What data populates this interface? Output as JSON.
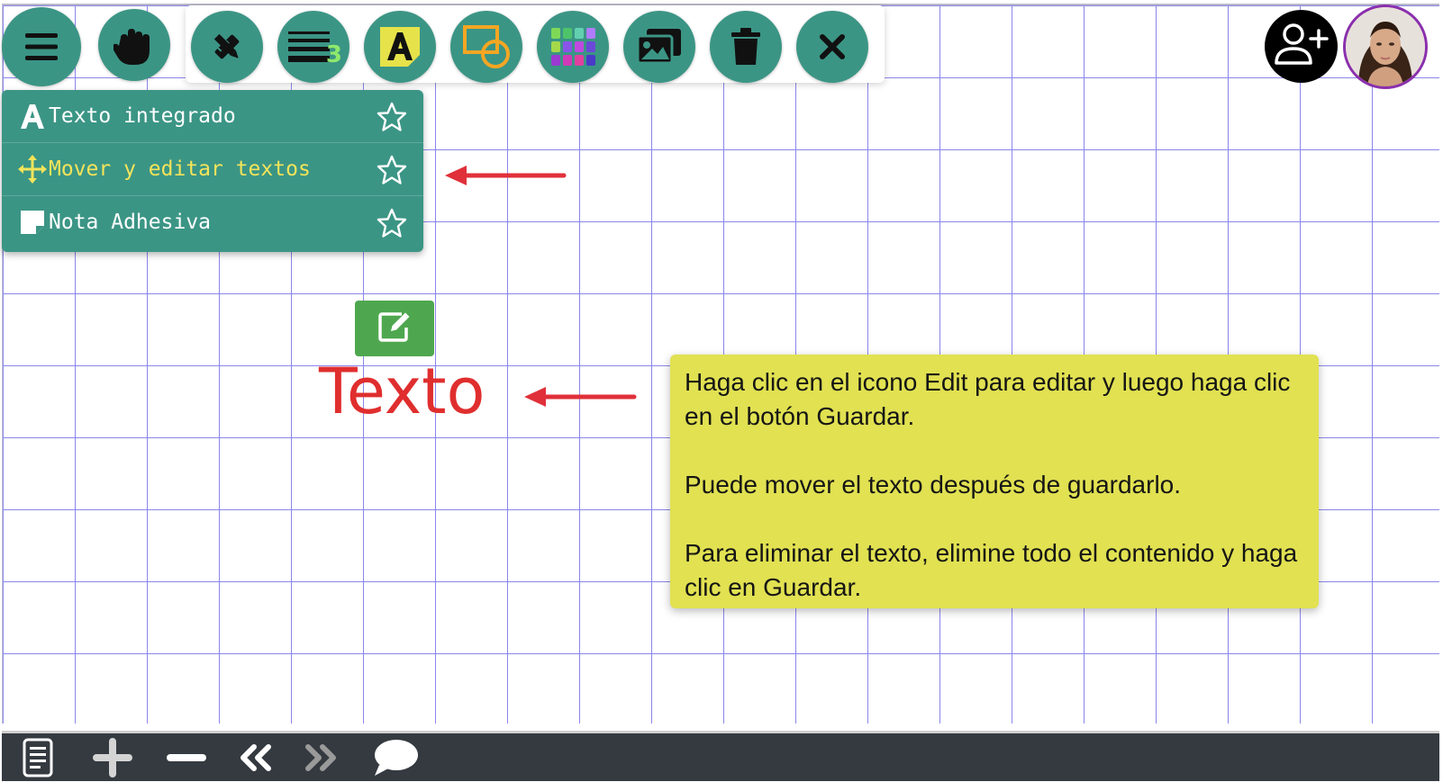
{
  "toolbar": {
    "items": [
      {
        "name": "menu",
        "icon": "hamburger-icon"
      },
      {
        "name": "hand",
        "icon": "hand-icon"
      },
      {
        "name": "draw",
        "icon": "pencil-ruler-icon"
      },
      {
        "name": "line-width",
        "icon": "line-width-icon",
        "badge": "3"
      },
      {
        "name": "text",
        "icon": "text-a-icon"
      },
      {
        "name": "shapes",
        "icon": "shapes-icon"
      },
      {
        "name": "colors",
        "icon": "color-palette-icon"
      },
      {
        "name": "images",
        "icon": "images-icon"
      },
      {
        "name": "delete",
        "icon": "trash-icon"
      },
      {
        "name": "close",
        "icon": "close-icon"
      }
    ],
    "accent": "#3b9585"
  },
  "text_menu": {
    "items": [
      {
        "label": "Texto integrado",
        "icon": "letter-a-icon"
      },
      {
        "label": "Mover y editar textos",
        "icon": "move-arrows-icon",
        "active": true
      },
      {
        "label": "Nota Adhesiva",
        "icon": "sticky-note-icon"
      }
    ],
    "active_color": "#f3e45a"
  },
  "canvas": {
    "sample_text": "Texto",
    "sample_text_color": "#e02e2e",
    "edit_button_icon": "edit-icon",
    "edit_button_color": "#4ea74f",
    "arrow_color": "#e0303a"
  },
  "sticky_note": {
    "paragraphs": [
      "Haga clic en el icono Edit para editar y luego haga clic en el botón Guardar.",
      "Puede mover el texto después de guardarlo.",
      "Para eliminar el texto, elimine todo el contenido y haga clic en Guardar."
    ],
    "color": "#e1e152"
  },
  "users": {
    "add_user_icon": "add-user-icon",
    "avatar": "user-avatar"
  },
  "bottom_bar": {
    "items": [
      {
        "name": "page",
        "icon": "page-icon"
      },
      {
        "name": "zoom-in",
        "icon": "plus-icon"
      },
      {
        "name": "zoom-out",
        "icon": "minus-icon"
      },
      {
        "name": "previous",
        "icon": "double-chevron-left-icon"
      },
      {
        "name": "next",
        "icon": "double-chevron-right-icon",
        "disabled": true
      },
      {
        "name": "chat",
        "icon": "chat-bubble-icon"
      }
    ]
  }
}
